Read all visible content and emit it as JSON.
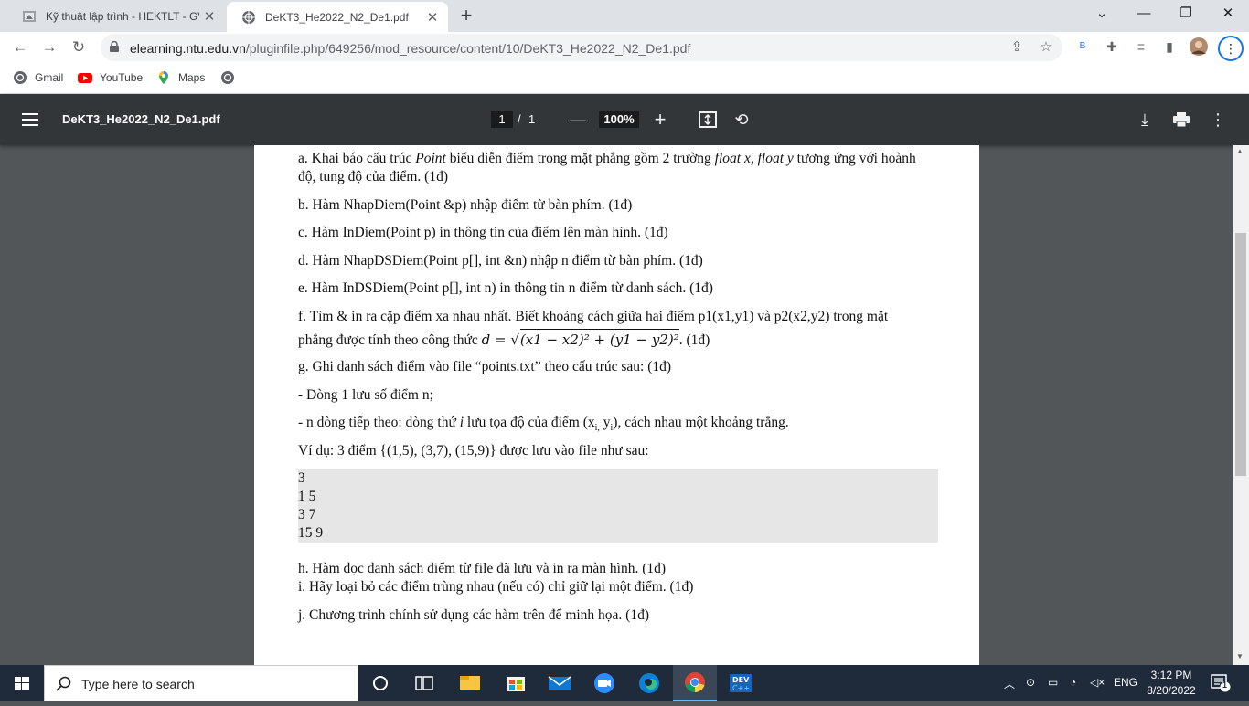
{
  "tabs": [
    {
      "title": "Kỹ thuật lập trình - HEKTLT - GV.",
      "active": false
    },
    {
      "title": "DeKT3_He2022_N2_De1.pdf",
      "active": true
    }
  ],
  "address": {
    "host": "elearning.ntu.edu.vn",
    "path": "/pluginfile.php/649256/mod_resource/content/10/DeKT3_He2022_N2_De1.pdf"
  },
  "bookmarks": [
    {
      "label": "Gmail",
      "icon": "google-icon"
    },
    {
      "label": "YouTube",
      "icon": "youtube-icon"
    },
    {
      "label": "Maps",
      "icon": "maps-icon"
    }
  ],
  "pdf": {
    "title": "DeKT3_He2022_N2_De1.pdf",
    "page": "1",
    "separator": "/",
    "total": "1",
    "zoom": "100%"
  },
  "document": {
    "a_pre": "a. Khai báo cấu trúc ",
    "a_point": "Point",
    "a_mid": " biểu diễn điểm trong mặt phẳng gồm 2 trường ",
    "a_fields": "float x, float y",
    "a_post": " tương ứng với hoành",
    "a_line2": "độ, tung độ của điểm. (1đ)",
    "b": "b. Hàm NhapDiem(Point &p) nhập điểm từ bàn phím. (1đ)",
    "c": "c. Hàm InDiem(Point p) in thông tin của điểm lên màn hình. (1đ)",
    "d": "d. Hàm NhapDSDiem(Point p[], int &n) nhập n điểm từ bàn phím. (1đ)",
    "e": "e. Hàm InDSDiem(Point p[], int n) in thông tin n điểm từ danh sách. (1đ)",
    "f_line1": "f. Tìm & in ra cặp điểm xa nhau nhất. Biết khoảng cách giữa hai điểm p1(x1,y1) và p2(x2,y2) trong mặt",
    "f_line2_pre": "phẳng được tính theo công thức ",
    "f_formula_lhs": "d = ",
    "f_formula_rad": "(x1 − x2)² + (y1 − y2)²",
    "f_line2_post": ". (1đ)",
    "g": "g. Ghi danh sách điểm vào file “points.txt” theo cấu trúc sau: (1đ)",
    "g1": "- Dòng 1 lưu số điểm n;",
    "g2_pre": "- n dòng tiếp theo: dòng thứ ",
    "g2_i": "i",
    "g2_mid": " lưu tọa độ của điểm (x",
    "g2_sub1": "i,",
    "g2_mid2": " y",
    "g2_sub2": "i",
    "g2_post": "), cách nhau một khoảng trắng.",
    "example": "Ví dụ: 3 điểm {(1,5), (3,7), (15,9)} được lưu vào file như sau:",
    "code": [
      "3",
      "1 5",
      "3 7",
      "15 9"
    ],
    "h": "h. Hàm đọc danh sách điểm từ file đã lưu và in ra màn hình. (1đ)",
    "i": "i. Hãy loại bỏ các điểm trùng nhau (nếu có) chỉ giữ lại một điểm. (1đ)",
    "j": "j. Chương trình chính sử dụng các hàm trên để minh họa. (1đ)"
  },
  "taskbar": {
    "search_placeholder": "Type here to search",
    "lang": "ENG",
    "time": "3:12 PM",
    "date": "8/20/2022",
    "notifications": "1"
  },
  "colors": {
    "tabstrip": "#dee1e6",
    "pdf_toolbar": "#323639",
    "viewer_bg": "#525659",
    "taskbar": "#1f2a3a",
    "code_bg": "#e6e6e6"
  }
}
